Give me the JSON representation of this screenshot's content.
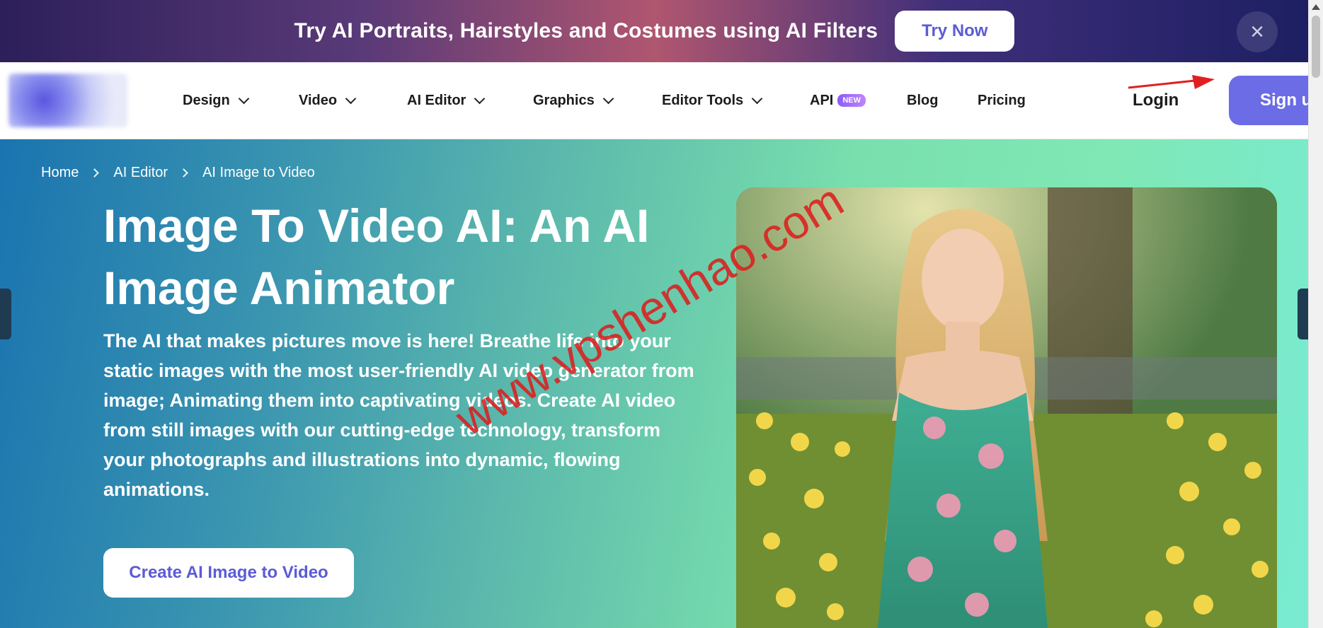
{
  "promo": {
    "text": "Try AI Portraits, Hairstyles and Costumes using AI Filters",
    "button": "Try Now",
    "close_icon": "×"
  },
  "nav": {
    "items": [
      {
        "label": "Design"
      },
      {
        "label": "Video"
      },
      {
        "label": "AI Editor"
      },
      {
        "label": "Graphics"
      },
      {
        "label": "Editor Tools"
      }
    ],
    "api": {
      "label": "API",
      "badge": "NEW"
    },
    "blog": "Blog",
    "pricing": "Pricing",
    "login": "Login",
    "signup": "Sign up"
  },
  "breadcrumb": [
    "Home",
    "AI Editor",
    "AI Image to Video"
  ],
  "hero": {
    "title": "Image To Video AI: An AI Image Animator",
    "description": "The AI that makes pictures move is here! Breathe life into your static images with the most user-friendly AI video generator from image; Animating them into captivating videos. Create AI video from still images with our cutting-edge technology, transform your photographs and illustrations into dynamic, flowing animations.",
    "cta": "Create AI Image to Video"
  },
  "watermark": "www.vpshenhao.com",
  "colors": {
    "accent": "#6b6ce6",
    "cta_text": "#5b5bd6",
    "watermark": "#dc1e1e"
  }
}
